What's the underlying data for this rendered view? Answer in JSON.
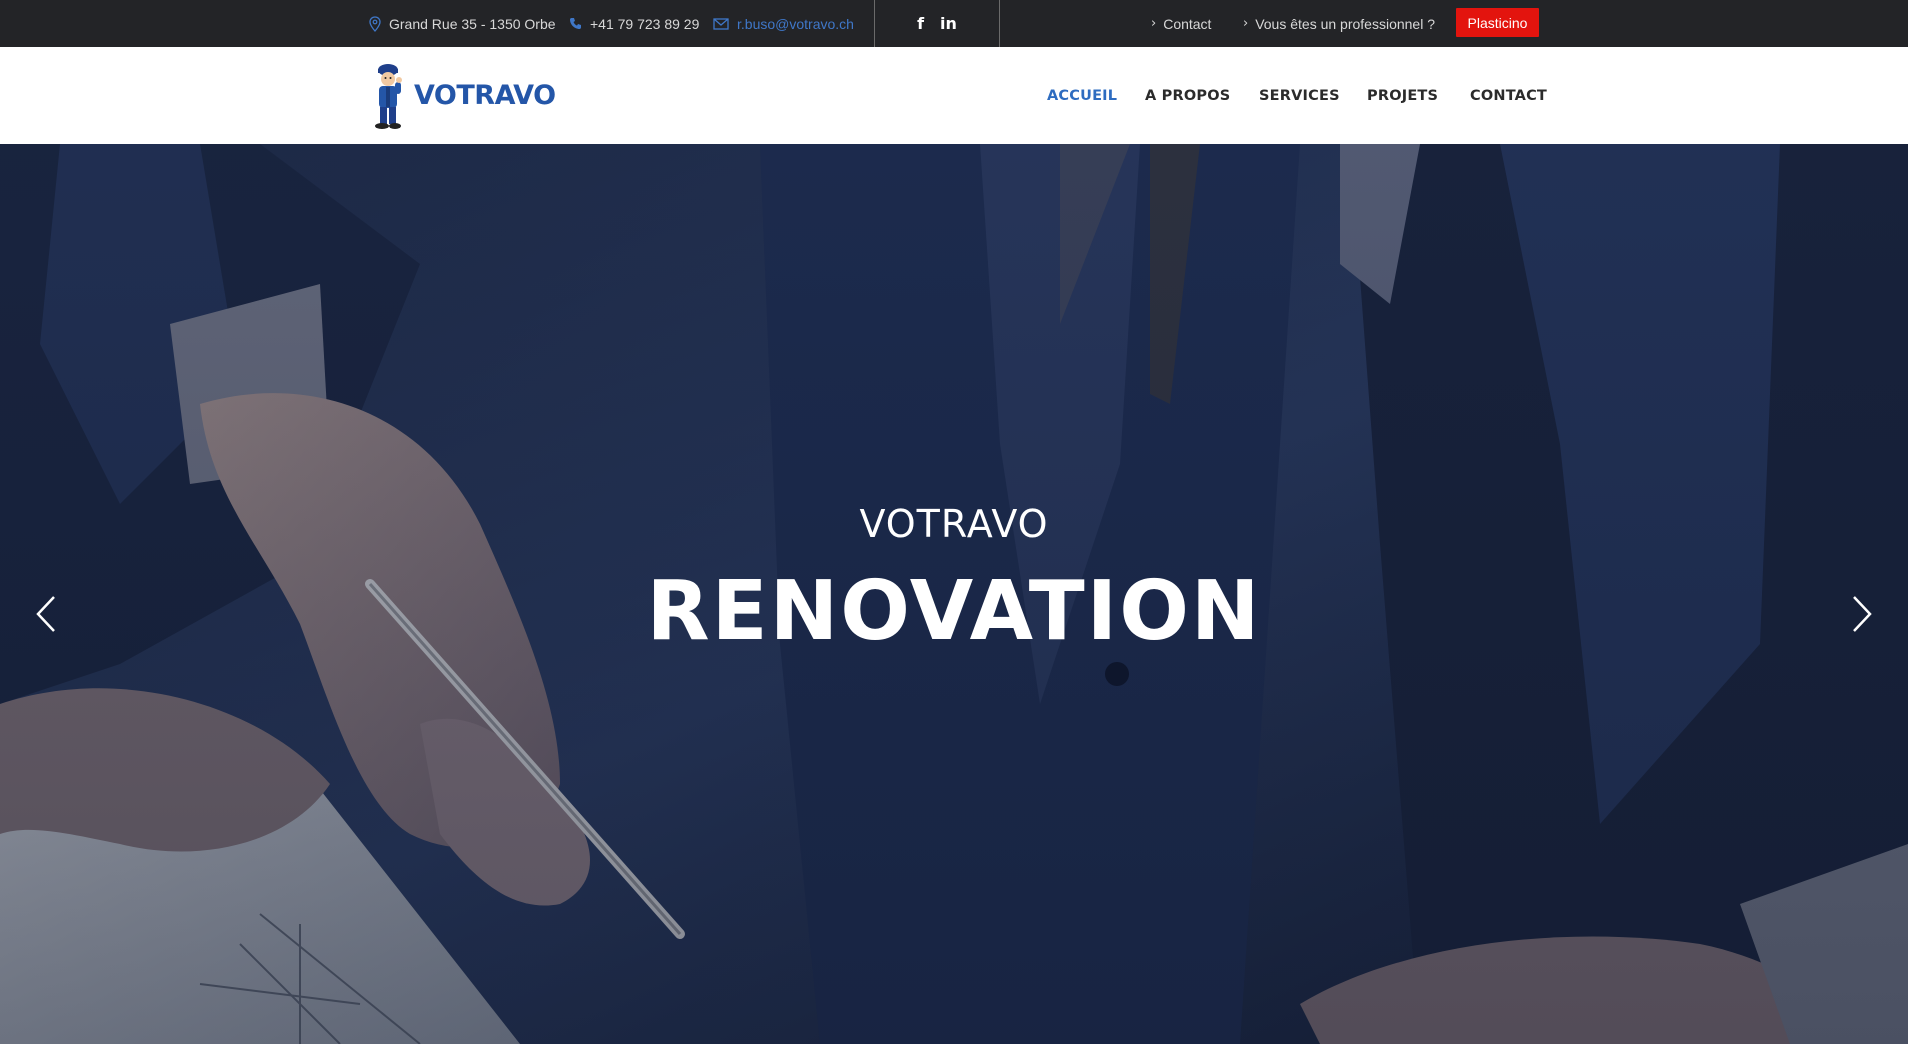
{
  "topbar": {
    "address": "Grand Rue 35 - 1350 Orbe",
    "phone": "+41 79 723 89 29",
    "email": "r.buso@votravo.ch",
    "social": {
      "facebook": "f",
      "linkedin": "in"
    },
    "links": [
      {
        "label": "Contact"
      },
      {
        "label": "Vous êtes un professionnel ?"
      }
    ],
    "button_label": "Plasticino",
    "icons": {
      "address": "map-pin-icon",
      "phone": "phone-icon",
      "email": "envelope-icon",
      "chevron": "chevron-right-icon"
    }
  },
  "header": {
    "logo_text": "VOTRAVO",
    "nav": [
      {
        "label": "ACCUEIL",
        "active": true
      },
      {
        "label": "A PROPOS",
        "active": false
      },
      {
        "label": "SERVICES",
        "active": false
      },
      {
        "label": "PROJETS",
        "active": false
      },
      {
        "label": "CONTACT",
        "active": false
      }
    ]
  },
  "hero": {
    "subtitle": "VOTRAVO",
    "title": "RENOVATION",
    "prev_icon": "chevron-left-icon",
    "next_icon": "chevron-right-icon"
  },
  "colors": {
    "topbar_bg": "#232427",
    "accent_blue": "#2e6cc0",
    "button_red": "#e3140e",
    "logo_blue": "#2456a8"
  }
}
